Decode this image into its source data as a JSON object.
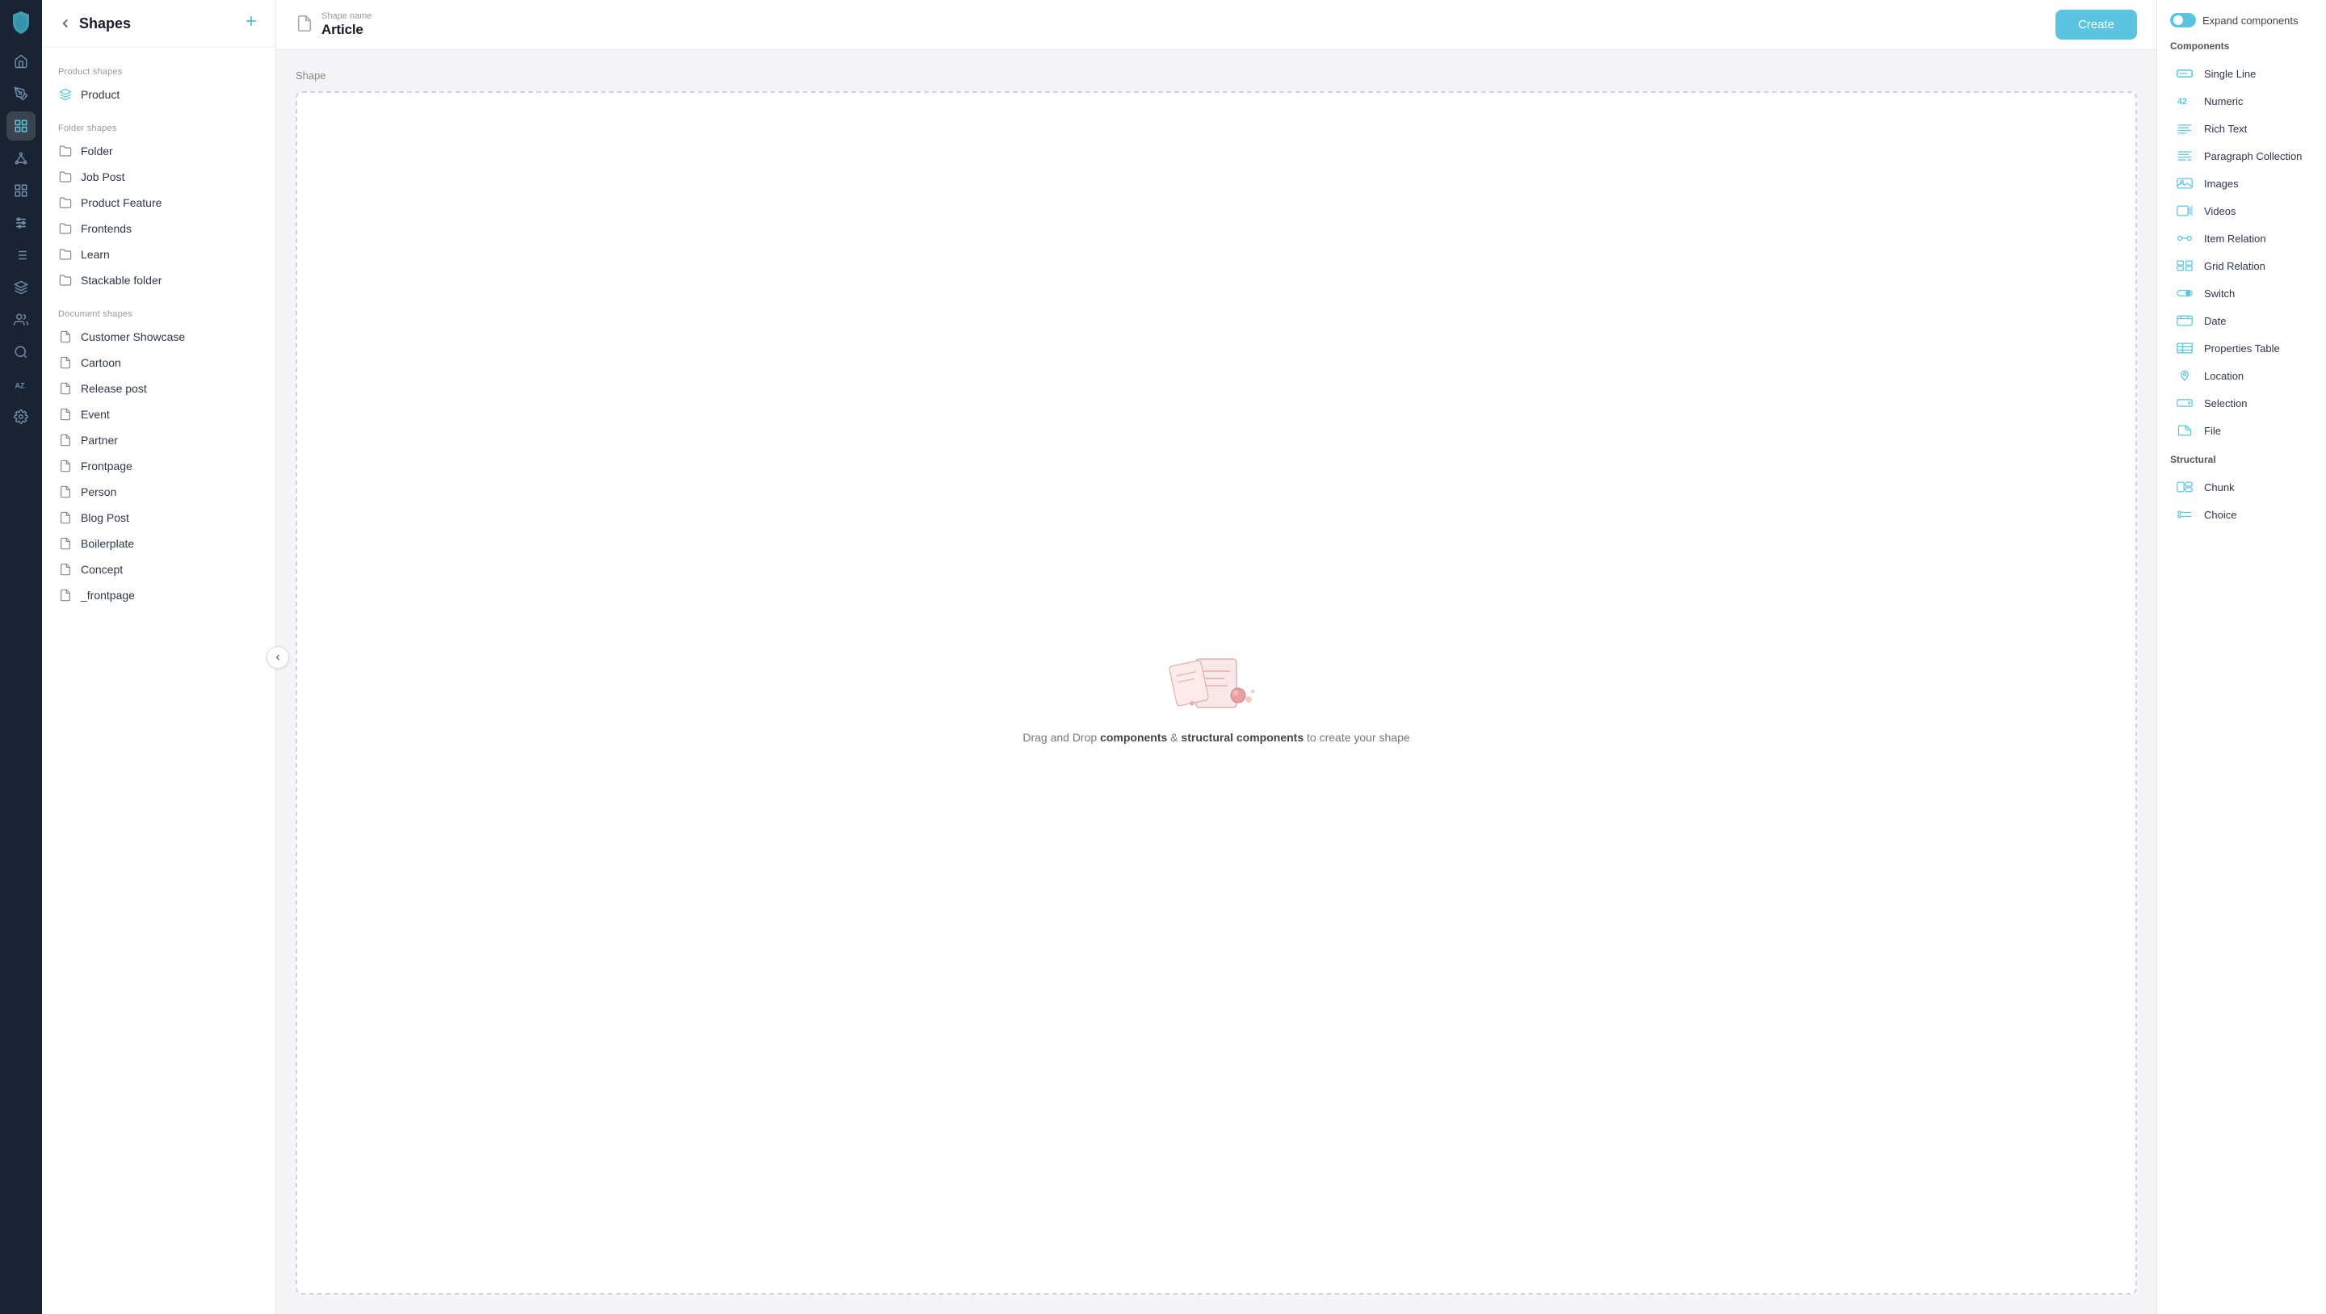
{
  "sidebar": {
    "title": "Shapes",
    "back_label": "back",
    "add_label": "add",
    "groups": [
      {
        "label": "Product shapes",
        "items": [
          {
            "name": "Product",
            "type": "product"
          }
        ]
      },
      {
        "label": "Folder shapes",
        "items": [
          {
            "name": "Folder",
            "type": "folder"
          },
          {
            "name": "Job Post",
            "type": "folder"
          },
          {
            "name": "Product Feature",
            "type": "folder"
          },
          {
            "name": "Frontends",
            "type": "folder"
          },
          {
            "name": "Learn",
            "type": "folder"
          },
          {
            "name": "Stackable folder",
            "type": "folder"
          }
        ]
      },
      {
        "label": "Document shapes",
        "items": [
          {
            "name": "Customer Showcase",
            "type": "document"
          },
          {
            "name": "Cartoon",
            "type": "document"
          },
          {
            "name": "Release post",
            "type": "document"
          },
          {
            "name": "Event",
            "type": "document"
          },
          {
            "name": "Partner",
            "type": "document"
          },
          {
            "name": "Frontpage",
            "type": "document"
          },
          {
            "name": "Person",
            "type": "document"
          },
          {
            "name": "Blog Post",
            "type": "document"
          },
          {
            "name": "Boilerplate",
            "type": "document"
          },
          {
            "name": "Concept",
            "type": "document"
          },
          {
            "name": "_frontpage",
            "type": "document"
          }
        ]
      }
    ]
  },
  "header": {
    "shape_name_label": "Shape name",
    "shape_name_value": "Article",
    "create_button_label": "Create"
  },
  "canvas": {
    "label": "Shape",
    "hint_text": "Drag and Drop ",
    "hint_bold1": "components",
    "hint_middle": " & ",
    "hint_bold2": "structural components",
    "hint_end": " to create your shape"
  },
  "right_panel": {
    "expand_label": "Expand components",
    "components_label": "Components",
    "components": [
      {
        "name": "Single Line",
        "icon": "single-line"
      },
      {
        "name": "Numeric",
        "icon": "numeric"
      },
      {
        "name": "Rich Text",
        "icon": "rich-text"
      },
      {
        "name": "Paragraph Collection",
        "icon": "paragraph-collection"
      },
      {
        "name": "Images",
        "icon": "images"
      },
      {
        "name": "Videos",
        "icon": "videos"
      },
      {
        "name": "Item Relation",
        "icon": "item-relation"
      },
      {
        "name": "Grid Relation",
        "icon": "grid-relation"
      },
      {
        "name": "Switch",
        "icon": "switch"
      },
      {
        "name": "Date",
        "icon": "date"
      },
      {
        "name": "Properties Table",
        "icon": "properties-table"
      },
      {
        "name": "Location",
        "icon": "location"
      },
      {
        "name": "Selection",
        "icon": "selection"
      },
      {
        "name": "File",
        "icon": "file"
      }
    ],
    "structural_label": "Structural",
    "structural": [
      {
        "name": "Chunk",
        "icon": "chunk"
      },
      {
        "name": "Choice",
        "icon": "choice"
      }
    ]
  },
  "nav_icons": [
    "home",
    "brush",
    "book-open",
    "layers",
    "bar-chart",
    "sliders",
    "users",
    "search",
    "az",
    "settings"
  ],
  "colors": {
    "accent": "#5bc4e0",
    "sidebar_bg": "#1a2332",
    "nav_icon": "#6b8caa"
  }
}
